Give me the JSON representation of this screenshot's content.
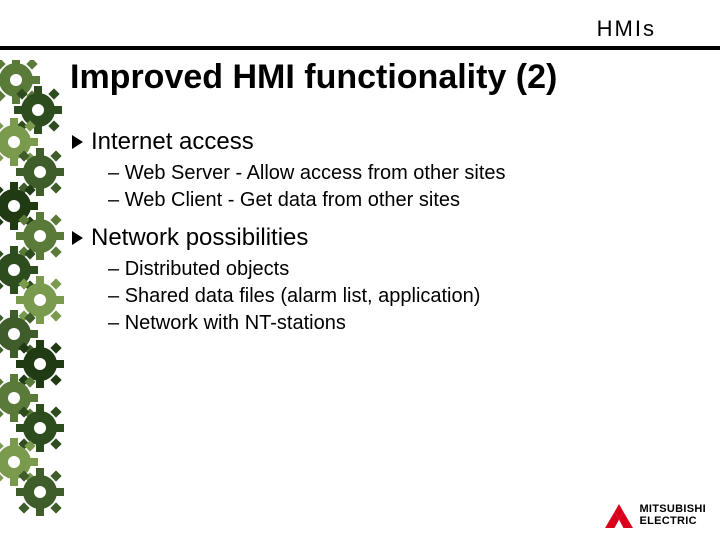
{
  "header": {
    "category": "HMIs"
  },
  "title": "Improved HMI functionality (2)",
  "bullets": [
    {
      "text": "Internet access",
      "sub": [
        "Web Server - Allow access from other sites",
        "Web Client - Get data from other sites"
      ]
    },
    {
      "text": "Network possibilities",
      "sub": [
        "Distributed objects",
        "Shared data files (alarm list, application)",
        "Network with NT-stations"
      ]
    }
  ],
  "logo": {
    "line1": "MITSUBISHI",
    "line2": "ELECTRIC"
  }
}
